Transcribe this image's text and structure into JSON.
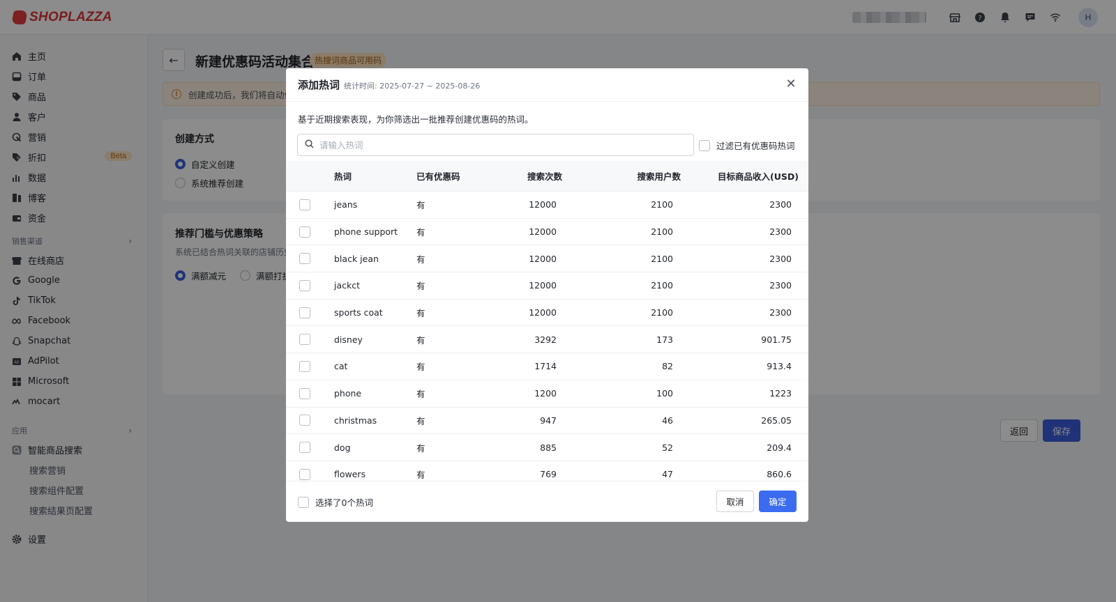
{
  "app": {
    "logo_text": "SHOPLAZZA",
    "avatar_initial": "H"
  },
  "topbar": {
    "icons": [
      "store-icon",
      "help-icon",
      "bell-icon",
      "message-icon",
      "wifi-icon"
    ]
  },
  "sidebar": {
    "main_items": [
      {
        "label": "主页",
        "icon": "home-icon"
      },
      {
        "label": "订单",
        "icon": "order-icon"
      },
      {
        "label": "商品",
        "icon": "tag-icon"
      },
      {
        "label": "客户",
        "icon": "user-icon"
      },
      {
        "label": "营销",
        "icon": "marketing-icon"
      },
      {
        "label": "折扣",
        "icon": "discount-icon",
        "badge": "Beta"
      },
      {
        "label": "数据",
        "icon": "chart-icon"
      },
      {
        "label": "博客",
        "icon": "blog-icon"
      },
      {
        "label": "资金",
        "icon": "wallet-icon"
      }
    ],
    "channels_heading": "销售渠道",
    "channels": [
      {
        "label": "在线商店",
        "icon": "store-icon"
      },
      {
        "label": "Google",
        "icon": "google-icon"
      },
      {
        "label": "TikTok",
        "icon": "tiktok-icon"
      },
      {
        "label": "Facebook",
        "icon": "meta-icon"
      },
      {
        "label": "Snapchat",
        "icon": "snapchat-icon"
      },
      {
        "label": "AdPilot",
        "icon": "adpilot-icon"
      },
      {
        "label": "Microsoft",
        "icon": "microsoft-icon"
      },
      {
        "label": "mocart",
        "icon": "mocart-icon"
      }
    ],
    "apps_heading": "应用",
    "apps": [
      {
        "label": "智能商品搜索",
        "icon": "smart-search-icon"
      }
    ],
    "app_subitems": [
      "搜索营销",
      "搜索组件配置",
      "搜索结果页配置"
    ],
    "settings_label": "设置"
  },
  "page": {
    "title": "新建优惠码活动集合",
    "title_badge": "热搜词商品可用码",
    "alert_text": "创建成功后，我们将自动停",
    "create_method": {
      "heading": "创建方式",
      "options": [
        "自定义创建",
        "系统推荐创建"
      ],
      "selected": "自定义创建"
    },
    "strategy": {
      "heading": "推荐门槛与优惠策略",
      "subtitle": "系统已结合热词关联的店铺历史",
      "options": [
        "满额减元",
        "满额打折"
      ],
      "selected": "满额减元"
    },
    "back_label": "返回",
    "save_label": "保存"
  },
  "modal": {
    "title": "添加热词",
    "stat_period": "统计时间: 2025-07-27 ~ 2025-08-26",
    "description": "基于近期搜索表现，为你筛选出一批推荐创建优惠码的热词。",
    "search_placeholder": "请输入热词",
    "filter_label": "过滤已有优惠码热词",
    "columns": [
      "热词",
      "已有优惠码",
      "搜索次数",
      "搜索用户数",
      "目标商品收入(USD)"
    ],
    "rows": [
      {
        "keyword": "jeans",
        "has_code": "有",
        "searches": "12000",
        "users": "2100",
        "revenue": "2300"
      },
      {
        "keyword": "phone support",
        "has_code": "有",
        "searches": "12000",
        "users": "2100",
        "revenue": "2300"
      },
      {
        "keyword": "black jean",
        "has_code": "有",
        "searches": "12000",
        "users": "2100",
        "revenue": "2300"
      },
      {
        "keyword": "jackct",
        "has_code": "有",
        "searches": "12000",
        "users": "2100",
        "revenue": "2300"
      },
      {
        "keyword": "sports coat",
        "has_code": "有",
        "searches": "12000",
        "users": "2100",
        "revenue": "2300"
      },
      {
        "keyword": "disney",
        "has_code": "有",
        "searches": "3292",
        "users": "173",
        "revenue": "901.75"
      },
      {
        "keyword": "cat",
        "has_code": "有",
        "searches": "1714",
        "users": "82",
        "revenue": "913.4"
      },
      {
        "keyword": "phone",
        "has_code": "有",
        "searches": "1200",
        "users": "100",
        "revenue": "1223"
      },
      {
        "keyword": "christmas",
        "has_code": "有",
        "searches": "947",
        "users": "46",
        "revenue": "265.05"
      },
      {
        "keyword": "dog",
        "has_code": "有",
        "searches": "885",
        "users": "52",
        "revenue": "209.4"
      },
      {
        "keyword": "flowers",
        "has_code": "有",
        "searches": "769",
        "users": "47",
        "revenue": "860.6"
      }
    ],
    "selected_count_label": "选择了0个热词",
    "cancel_label": "取消",
    "confirm_label": "确定"
  },
  "colors": {
    "primary": "#3b6cf0",
    "brand_red": "#d93636",
    "badge_bg": "#fbe2c0"
  }
}
